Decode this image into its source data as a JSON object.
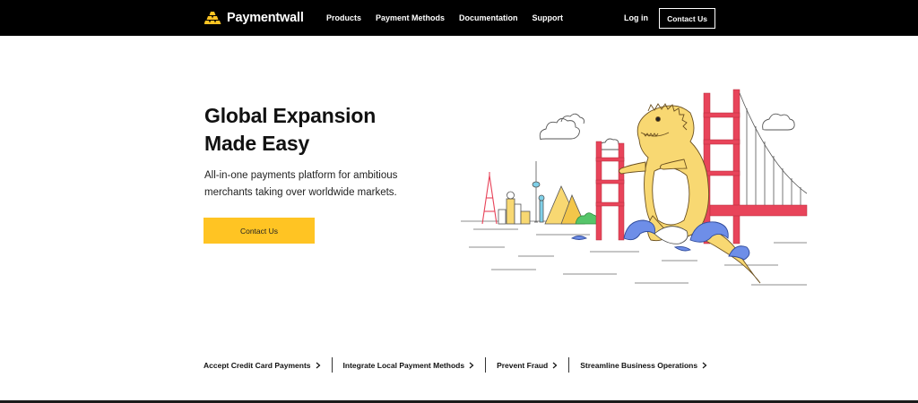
{
  "nav": {
    "brand": "Paymentwall",
    "links": [
      "Products",
      "Payment Methods",
      "Documentation",
      "Support"
    ],
    "login": "Log in",
    "contact": "Contact Us"
  },
  "hero": {
    "title_line1": "Global Expansion",
    "title_line2": "Made Easy",
    "subtitle_line1": "All-in-one payments platform for ambitious",
    "subtitle_line2": "merchants taking over worldwide markets.",
    "cta": "Contact Us"
  },
  "features": [
    "Accept Credit Card Payments",
    "Integrate Local Payment Methods",
    "Prevent Fraud",
    "Streamline Business Operations"
  ],
  "colors": {
    "nav_bg": "#000000",
    "accent": "#ffc423",
    "bridge": "#e8445a",
    "monster": "#f8d872",
    "wave": "#6e8ee8"
  },
  "icons": {
    "logo": "gold-bars-icon",
    "feature_arrow": "chevron-right-icon"
  }
}
